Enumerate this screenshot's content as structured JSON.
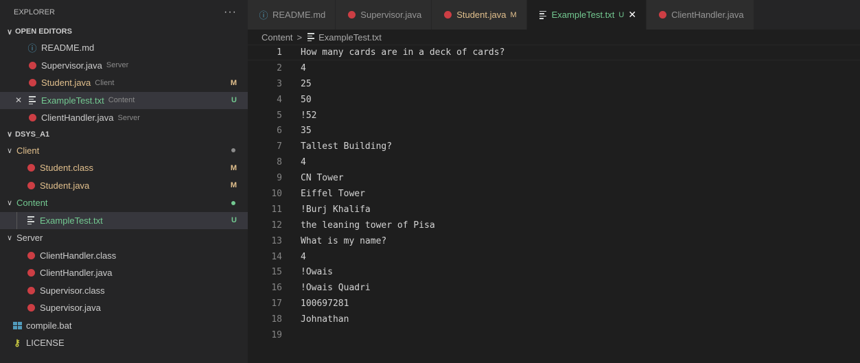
{
  "explorer": {
    "title": "EXPLORER",
    "more": "···",
    "open_editors": {
      "title": "OPEN EDITORS",
      "items": [
        {
          "icon": "info-icon",
          "label": "README.md",
          "desc": "",
          "status": "",
          "color": "#cccccc"
        },
        {
          "icon": "java-icon",
          "label": "Supervisor.java",
          "desc": "Server",
          "status": "",
          "color": "#cccccc"
        },
        {
          "icon": "java-icon",
          "label": "Student.java",
          "desc": "Client",
          "status": "M",
          "color": "#e2c08d"
        },
        {
          "icon": "text-file-icon",
          "label": "ExampleTest.txt",
          "desc": "Content",
          "status": "U",
          "color": "#73c991"
        },
        {
          "icon": "java-icon",
          "label": "ClientHandler.java",
          "desc": "Server",
          "status": "",
          "color": "#cccccc"
        }
      ]
    },
    "workspace": {
      "title": "DSYS_A1",
      "folders": [
        {
          "label": "Client",
          "color": "#e2c08d",
          "dot": "#8b8b8b",
          "files": [
            {
              "icon": "java-icon",
              "label": "Student.class",
              "status": "M",
              "color": "#e2c08d"
            },
            {
              "icon": "java-icon",
              "label": "Student.java",
              "status": "M",
              "color": "#e2c08d"
            }
          ]
        },
        {
          "label": "Content",
          "color": "#73c991",
          "dot": "#73c991",
          "files": [
            {
              "icon": "text-file-icon",
              "label": "ExampleTest.txt",
              "status": "U",
              "color": "#73c991"
            }
          ]
        },
        {
          "label": "Server",
          "color": "#cccccc",
          "dot": "",
          "files": [
            {
              "icon": "java-icon",
              "label": "ClientHandler.class",
              "status": "",
              "color": "#cccccc"
            },
            {
              "icon": "java-icon",
              "label": "ClientHandler.java",
              "status": "",
              "color": "#cccccc"
            },
            {
              "icon": "java-icon",
              "label": "Supervisor.class",
              "status": "",
              "color": "#cccccc"
            },
            {
              "icon": "java-icon",
              "label": "Supervisor.java",
              "status": "",
              "color": "#cccccc"
            }
          ]
        }
      ],
      "root_files": [
        {
          "icon": "windows-icon",
          "label": "compile.bat"
        },
        {
          "icon": "license-icon",
          "label": "LICENSE"
        }
      ]
    }
  },
  "tabs": [
    {
      "icon": "info-icon",
      "label": "README.md",
      "status": "",
      "active": false,
      "color": "#969696"
    },
    {
      "icon": "java-icon",
      "label": "Supervisor.java",
      "status": "",
      "active": false,
      "color": "#969696"
    },
    {
      "icon": "java-icon",
      "label": "Student.java",
      "status": "M",
      "active": false,
      "color": "#e2c08d"
    },
    {
      "icon": "text-file-icon",
      "label": "ExampleTest.txt",
      "status": "U",
      "active": true,
      "color": "#73c991"
    },
    {
      "icon": "java-icon",
      "label": "ClientHandler.java",
      "status": "",
      "active": false,
      "color": "#969696"
    }
  ],
  "breadcrumb": {
    "folder": "Content",
    "separator": ">",
    "file": "ExampleTest.txt"
  },
  "editor": {
    "current_line": 1,
    "lines": [
      "How many cards are in a deck of cards?",
      "4",
      "25",
      "50",
      "!52",
      "35",
      "Tallest Building?",
      "4",
      "CN Tower",
      "Eiffel Tower",
      "!Burj Khalifa",
      "the leaning tower of Pisa",
      "What is my name?",
      "4",
      "!Owais",
      "!Owais Quadri",
      "100697281",
      "Johnathan",
      ""
    ]
  }
}
